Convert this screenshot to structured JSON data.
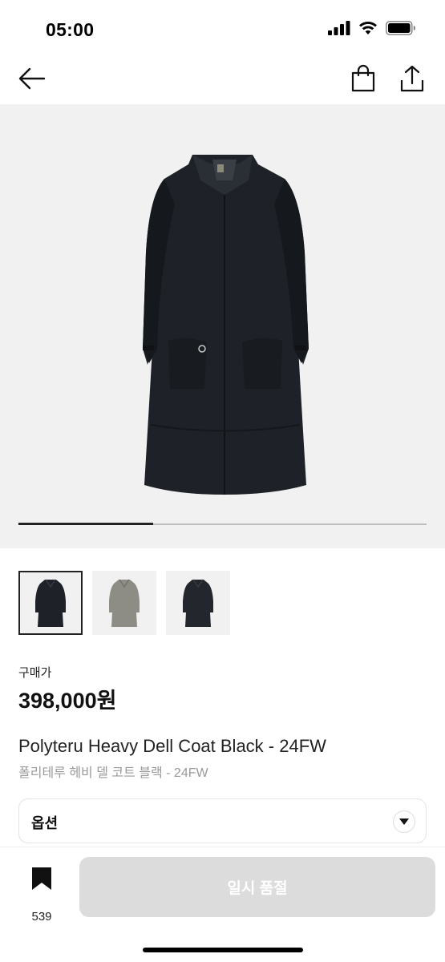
{
  "status_bar": {
    "time": "05:00",
    "icons": [
      "signal-icon",
      "wifi-icon",
      "battery-icon"
    ]
  },
  "nav": {
    "icons": [
      "back-arrow-icon",
      "shopping-bag-icon",
      "share-icon"
    ]
  },
  "gallery": {
    "main_image": "black-long-coat",
    "progress_fraction": 0.33,
    "thumbnails": [
      {
        "image": "black-coat-thumbnail",
        "selected": true
      },
      {
        "image": "grey-coat-thumbnail",
        "selected": false
      },
      {
        "image": "black-coat-alt-thumbnail",
        "selected": false
      }
    ]
  },
  "price": {
    "label": "구매가",
    "value": "398,000원"
  },
  "product": {
    "title_en": "Polyteru Heavy Dell Coat Black - 24FW",
    "title_ko": "폴리테루 헤비 델 코트 블랙 - 24FW"
  },
  "options": {
    "label": "옵션",
    "icon": "chevron-down-icon"
  },
  "bottom": {
    "bookmark_icon": "bookmark-icon",
    "bookmark_count": "539",
    "sold_out_label": "일시 품절"
  },
  "colors": {
    "button_disabled": "#dcdcdc",
    "image_background": "#f1f1f1",
    "text_secondary": "#9a9a9a"
  }
}
